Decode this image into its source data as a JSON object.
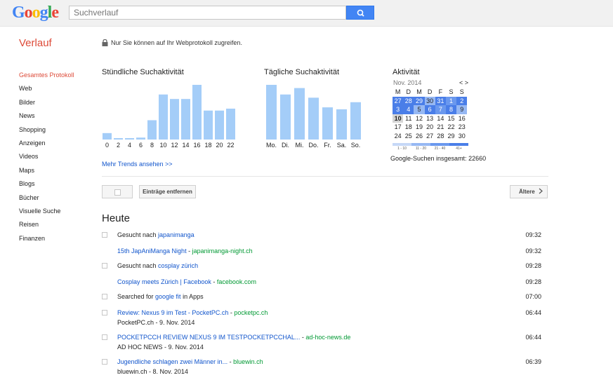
{
  "header": {
    "logo_letters": [
      {
        "ch": "G",
        "color": "#4285f4"
      },
      {
        "ch": "o",
        "color": "#ea4335"
      },
      {
        "ch": "o",
        "color": "#fbbc05"
      },
      {
        "ch": "g",
        "color": "#4285f4"
      },
      {
        "ch": "l",
        "color": "#34a853"
      },
      {
        "ch": "e",
        "color": "#ea4335"
      }
    ],
    "search_placeholder": "Suchverlauf",
    "search_icon": "search-icon"
  },
  "page": {
    "title": "Verlauf",
    "privacy_text": "Nur Sie können auf Ihr Webprotokoll zugreifen.",
    "privacy_icon": "lock-icon"
  },
  "sidebar": {
    "items": [
      {
        "label": "Gesamtes Protokoll",
        "active": true
      },
      {
        "label": "Web"
      },
      {
        "label": "Bilder"
      },
      {
        "label": "News"
      },
      {
        "label": "Shopping"
      },
      {
        "label": "Anzeigen"
      },
      {
        "label": "Videos"
      },
      {
        "label": "Maps"
      },
      {
        "label": "Blogs"
      },
      {
        "label": "Bücher"
      },
      {
        "label": "Visuelle Suche"
      },
      {
        "label": "Reisen"
      },
      {
        "label": "Finanzen"
      }
    ]
  },
  "hourly": {
    "title": "Stündliche Suchaktivität",
    "categories": [
      "0",
      "",
      "2",
      "",
      "4",
      "",
      "6",
      "",
      "8",
      "",
      "10",
      "",
      "12",
      "",
      "14",
      "",
      "16",
      "",
      "18",
      "",
      "20",
      "",
      "22",
      ""
    ],
    "tick_labels": [
      "0",
      "2",
      "4",
      "6",
      "8",
      "10",
      "12",
      "14",
      "16",
      "18",
      "20",
      "22"
    ],
    "values": [
      10,
      2,
      2,
      3,
      30,
      70,
      63,
      63,
      85,
      45,
      45,
      48
    ]
  },
  "daily": {
    "title": "Tägliche Suchaktivität",
    "categories": [
      "Mo.",
      "Di.",
      "Mi.",
      "Do.",
      "Fr.",
      "Sa.",
      "So."
    ],
    "values": [
      85,
      70,
      80,
      65,
      50,
      47,
      58
    ]
  },
  "more_trends": "Mehr Trends ansehen >>",
  "calendar": {
    "title": "Aktivität",
    "month": "Nov. 2014",
    "nav": "< >",
    "weekdays": [
      "M",
      "D",
      "M",
      "D",
      "F",
      "S",
      "S"
    ],
    "weeks": [
      [
        {
          "d": "27",
          "l": "l4"
        },
        {
          "d": "28",
          "l": "l4"
        },
        {
          "d": "29",
          "l": "l4"
        },
        {
          "d": "30",
          "l": "l2"
        },
        {
          "d": "31",
          "l": "l4"
        },
        {
          "d": "1",
          "l": "l3"
        },
        {
          "d": "2",
          "l": "l4"
        }
      ],
      [
        {
          "d": "3",
          "l": "l4"
        },
        {
          "d": "4",
          "l": "l4"
        },
        {
          "d": "5",
          "l": "l2"
        },
        {
          "d": "6",
          "l": "l4"
        },
        {
          "d": "7",
          "l": "l3"
        },
        {
          "d": "8",
          "l": "l4"
        },
        {
          "d": "9",
          "l": "l2"
        }
      ],
      [
        {
          "d": "10",
          "l": "today"
        },
        {
          "d": "11",
          "l": ""
        },
        {
          "d": "12",
          "l": ""
        },
        {
          "d": "13",
          "l": ""
        },
        {
          "d": "14",
          "l": ""
        },
        {
          "d": "15",
          "l": ""
        },
        {
          "d": "16",
          "l": ""
        }
      ],
      [
        {
          "d": "17",
          "l": ""
        },
        {
          "d": "18",
          "l": ""
        },
        {
          "d": "19",
          "l": ""
        },
        {
          "d": "20",
          "l": ""
        },
        {
          "d": "21",
          "l": ""
        },
        {
          "d": "22",
          "l": ""
        },
        {
          "d": "23",
          "l": ""
        }
      ],
      [
        {
          "d": "24",
          "l": ""
        },
        {
          "d": "25",
          "l": ""
        },
        {
          "d": "26",
          "l": ""
        },
        {
          "d": "27",
          "l": ""
        },
        {
          "d": "28",
          "l": ""
        },
        {
          "d": "29",
          "l": ""
        },
        {
          "d": "30",
          "l": ""
        }
      ]
    ],
    "legend": [
      {
        "label": "1 - 10",
        "color": "#c6d8f7"
      },
      {
        "label": "11 - 20",
        "color": "#96b8f3"
      },
      {
        "label": "21 - 40",
        "color": "#6a98ee"
      },
      {
        "label": "41+",
        "color": "#4a7ee8"
      }
    ],
    "total": "Google-Suchen insgesamt: 22660"
  },
  "toolbar": {
    "remove_label": "Einträge entfernen",
    "older_label": "Ältere"
  },
  "history": {
    "heading": "Heute",
    "rows": [
      {
        "prefix": "Gesucht nach ",
        "link": "japanimanga",
        "domain": "",
        "time": "09:32",
        "checkbox": true,
        "sub": ""
      },
      {
        "prefix": "",
        "link": "15th JapAniManga Night",
        "domain": "japanimanga-night.ch",
        "time": "09:32",
        "checkbox": false,
        "sub": ""
      },
      {
        "prefix": "Gesucht nach ",
        "link": "cosplay zürich",
        "domain": "",
        "time": "09:28",
        "checkbox": true,
        "sub": ""
      },
      {
        "prefix": "",
        "link": "Cosplay meets Zürich | Facebook",
        "domain": "facebook.com",
        "time": "09:28",
        "checkbox": false,
        "sub": ""
      },
      {
        "prefix": "Searched for ",
        "link": "google fit",
        "suffix": " in Apps",
        "domain": "",
        "time": "07:00",
        "checkbox": true,
        "sub": ""
      },
      {
        "prefix": "",
        "link": "Review: Nexus 9 im Test - PocketPC.ch",
        "domain": "pocketpc.ch",
        "time": "06:44",
        "checkbox": true,
        "sub": "PocketPC.ch - 9. Nov. 2014"
      },
      {
        "prefix": "",
        "link": "POCKETPCCH REVIEW NEXUS 9 IM TESTPOCKETPCCHAL...",
        "domain": "ad-hoc-news.de",
        "time": "06:44",
        "checkbox": true,
        "sub": "AD HOC NEWS - 9. Nov. 2014"
      },
      {
        "prefix": "",
        "link": "Jugendliche schlagen zwei Männer in...",
        "domain": "bluewin.ch",
        "time": "06:39",
        "checkbox": true,
        "sub": "bluewin.ch  - 8. Nov. 2014"
      }
    ]
  },
  "colors": {
    "accent_red": "#dd4b39",
    "bar_blue": "#a4cdf8",
    "link_blue": "#1155cc",
    "domain_green": "#009933"
  }
}
